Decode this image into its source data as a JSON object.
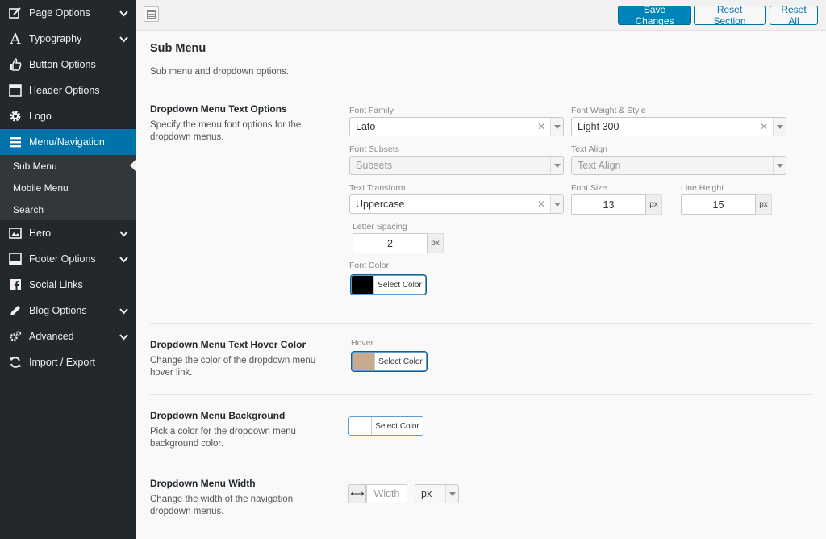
{
  "sidebar": {
    "items": [
      {
        "label": "Page Options",
        "icon": "edit-icon",
        "has_chevron": true
      },
      {
        "label": "Typography",
        "icon": "typography-icon",
        "has_chevron": true
      },
      {
        "label": "Button Options",
        "icon": "thumbs-up-icon",
        "has_chevron": false
      },
      {
        "label": "Header Options",
        "icon": "header-icon",
        "has_chevron": false
      },
      {
        "label": "Logo",
        "icon": "gear-icon",
        "has_chevron": false
      },
      {
        "label": "Menu/Navigation",
        "icon": "menu-icon",
        "has_chevron": false
      },
      {
        "label": "Hero",
        "icon": "image-icon",
        "has_chevron": true
      },
      {
        "label": "Footer Options",
        "icon": "footer-icon",
        "has_chevron": true
      },
      {
        "label": "Social Links",
        "icon": "facebook-icon",
        "has_chevron": false
      },
      {
        "label": "Blog Options",
        "icon": "pencil-icon",
        "has_chevron": true
      },
      {
        "label": "Advanced",
        "icon": "gears-icon",
        "has_chevron": true
      },
      {
        "label": "Import / Export",
        "icon": "refresh-icon",
        "has_chevron": false
      }
    ],
    "submenu": [
      "Sub Menu",
      "Mobile Menu",
      "Search"
    ]
  },
  "toolbar": {
    "save_label": "Save Changes",
    "reset_section_label": "Reset Section",
    "reset_all_label": "Reset All"
  },
  "section": {
    "title": "Sub Menu",
    "desc": "Sub menu and dropdown options."
  },
  "text_options": {
    "title": "Dropdown Menu Text Options",
    "desc": "Specify the menu font options for the dropdown menus.",
    "font_family_label": "Font Family",
    "font_family_value": "Lato",
    "font_weight_label": "Font Weight & Style",
    "font_weight_value": "Light 300",
    "font_subsets_label": "Font Subsets",
    "font_subsets_placeholder": "Subsets",
    "text_align_label": "Text Align",
    "text_align_placeholder": "Text Align",
    "text_transform_label": "Text Transform",
    "text_transform_value": "Uppercase",
    "font_size_label": "Font Size",
    "font_size_value": "13",
    "line_height_label": "Line Height",
    "line_height_value": "15",
    "letter_spacing_label": "Letter Spacing",
    "letter_spacing_value": "2",
    "unit": "px",
    "font_color_label": "Font Color",
    "font_color": "#000000",
    "select_color_label": "Select Color"
  },
  "hover": {
    "title": "Dropdown Menu Text Hover Color",
    "desc": "Change the color of the dropdown menu hover link.",
    "label": "Hover",
    "color": "#c8aa8e",
    "select_color_label": "Select Color"
  },
  "background": {
    "title": "Dropdown Menu Background",
    "desc": "Pick a color for the dropdown menu background color.",
    "color": "#ffffff",
    "select_color_label": "Select Color"
  },
  "width": {
    "title": "Dropdown Menu Width",
    "desc": "Change the width of the navigation dropdown menus.",
    "placeholder": "Width",
    "unit_value": "px"
  },
  "colors": {
    "sidebar_bg": "#23282d",
    "active": "#0073aa",
    "primary_button": "#0085ba"
  }
}
